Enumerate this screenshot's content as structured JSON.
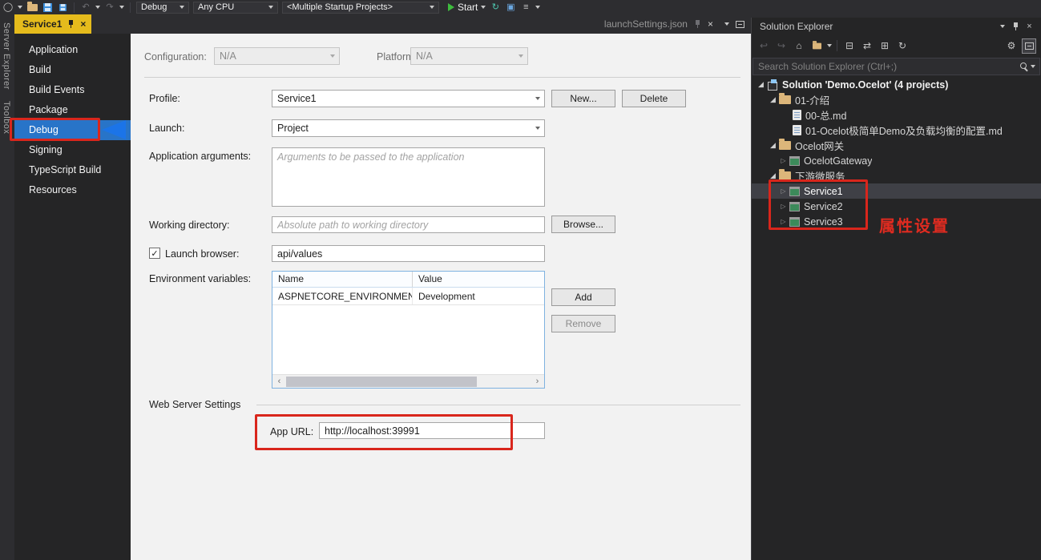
{
  "toolbar": {
    "configuration_combo": "Debug",
    "platform_combo": "Any CPU",
    "startup_projects_combo": "<Multiple Startup Projects>",
    "start_button": "Start"
  },
  "document_tabs": {
    "active_tab": "Service1",
    "background_tab": "launchSettings.json"
  },
  "left_tool_tabs": {
    "server_explorer": "Server Explorer",
    "toolbox": "Toolbox"
  },
  "property_nav": {
    "items": [
      "Application",
      "Build",
      "Build Events",
      "Package",
      "Debug",
      "Signing",
      "TypeScript Build",
      "Resources"
    ],
    "selected": "Debug"
  },
  "properties_page": {
    "configuration_label": "Configuration:",
    "configuration_value": "N/A",
    "platform_label": "Platform:",
    "platform_value": "N/A",
    "profile_label": "Profile:",
    "profile_value": "Service1",
    "new_button": "New...",
    "delete_button": "Delete",
    "launch_label": "Launch:",
    "launch_value": "Project",
    "application_arguments_label": "Application arguments:",
    "application_arguments_placeholder": "Arguments to be passed to the application",
    "working_directory_label": "Working directory:",
    "working_directory_placeholder": "Absolute path to working directory",
    "browse_button": "Browse...",
    "launch_browser_label": "Launch browser:",
    "launch_browser_checked": true,
    "launch_browser_value": "api/values",
    "environment_variables_label": "Environment variables:",
    "environment_variables_table": {
      "columns": [
        "Name",
        "Value"
      ],
      "rows": [
        [
          "ASPNETCORE_ENVIRONMENT",
          "Development"
        ]
      ]
    },
    "add_button": "Add",
    "remove_button": "Remove",
    "web_server_settings_label": "Web Server Settings",
    "app_url_label": "App URL:",
    "app_url_value": "http://localhost:39991"
  },
  "solution_explorer": {
    "title": "Solution Explorer",
    "search_placeholder": "Search Solution Explorer (Ctrl+;)",
    "tree": [
      {
        "label": "Solution 'Demo.Ocelot' (4 projects)",
        "type": "solution",
        "expanded": true
      },
      {
        "label": "01-介绍",
        "type": "folder",
        "expanded": true
      },
      {
        "label": "00-总.md",
        "type": "file"
      },
      {
        "label": "01-Ocelot极简单Demo及负载均衡的配置.md",
        "type": "file"
      },
      {
        "label": "Ocelot网关",
        "type": "folder",
        "expanded": true
      },
      {
        "label": "OcelotGateway",
        "type": "project",
        "expanded": false
      },
      {
        "label": "下游微服务",
        "type": "folder",
        "expanded": true
      },
      {
        "label": "Service1",
        "type": "project",
        "expanded": false,
        "selected": true
      },
      {
        "label": "Service2",
        "type": "project",
        "expanded": false
      },
      {
        "label": "Service3",
        "type": "project",
        "expanded": false
      }
    ]
  },
  "annotations": {
    "note_text": "属性设置"
  },
  "colors": {
    "active_tab_gold": "#e5bb1c",
    "nav_selection_blue": "#2874c8",
    "annotation_red": "#d9261c",
    "arrow_blue": "#1b74e8",
    "explorer_selection": "#3f4046",
    "folder_icon": "#dcb67a",
    "start_green": "#3ebc3e"
  }
}
